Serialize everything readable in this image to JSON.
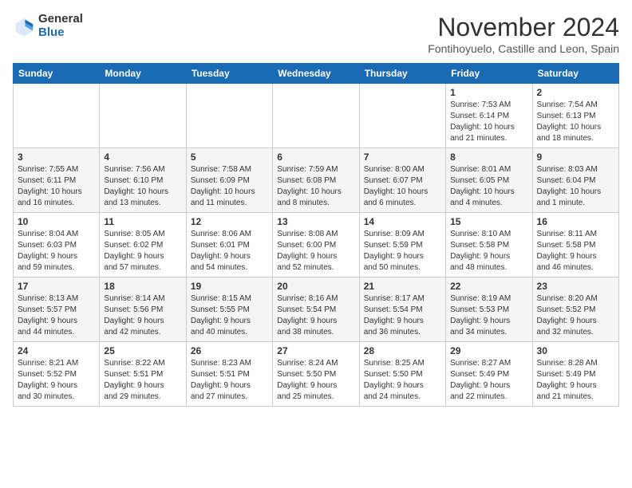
{
  "header": {
    "logo_general": "General",
    "logo_blue": "Blue",
    "month_title": "November 2024",
    "location": "Fontihoyuelo, Castille and Leon, Spain"
  },
  "days_of_week": [
    "Sunday",
    "Monday",
    "Tuesday",
    "Wednesday",
    "Thursday",
    "Friday",
    "Saturday"
  ],
  "weeks": [
    [
      {
        "day": "",
        "info": ""
      },
      {
        "day": "",
        "info": ""
      },
      {
        "day": "",
        "info": ""
      },
      {
        "day": "",
        "info": ""
      },
      {
        "day": "",
        "info": ""
      },
      {
        "day": "1",
        "info": "Sunrise: 7:53 AM\nSunset: 6:14 PM\nDaylight: 10 hours\nand 21 minutes."
      },
      {
        "day": "2",
        "info": "Sunrise: 7:54 AM\nSunset: 6:13 PM\nDaylight: 10 hours\nand 18 minutes."
      }
    ],
    [
      {
        "day": "3",
        "info": "Sunrise: 7:55 AM\nSunset: 6:11 PM\nDaylight: 10 hours\nand 16 minutes."
      },
      {
        "day": "4",
        "info": "Sunrise: 7:56 AM\nSunset: 6:10 PM\nDaylight: 10 hours\nand 13 minutes."
      },
      {
        "day": "5",
        "info": "Sunrise: 7:58 AM\nSunset: 6:09 PM\nDaylight: 10 hours\nand 11 minutes."
      },
      {
        "day": "6",
        "info": "Sunrise: 7:59 AM\nSunset: 6:08 PM\nDaylight: 10 hours\nand 8 minutes."
      },
      {
        "day": "7",
        "info": "Sunrise: 8:00 AM\nSunset: 6:07 PM\nDaylight: 10 hours\nand 6 minutes."
      },
      {
        "day": "8",
        "info": "Sunrise: 8:01 AM\nSunset: 6:05 PM\nDaylight: 10 hours\nand 4 minutes."
      },
      {
        "day": "9",
        "info": "Sunrise: 8:03 AM\nSunset: 6:04 PM\nDaylight: 10 hours\nand 1 minute."
      }
    ],
    [
      {
        "day": "10",
        "info": "Sunrise: 8:04 AM\nSunset: 6:03 PM\nDaylight: 9 hours\nand 59 minutes."
      },
      {
        "day": "11",
        "info": "Sunrise: 8:05 AM\nSunset: 6:02 PM\nDaylight: 9 hours\nand 57 minutes."
      },
      {
        "day": "12",
        "info": "Sunrise: 8:06 AM\nSunset: 6:01 PM\nDaylight: 9 hours\nand 54 minutes."
      },
      {
        "day": "13",
        "info": "Sunrise: 8:08 AM\nSunset: 6:00 PM\nDaylight: 9 hours\nand 52 minutes."
      },
      {
        "day": "14",
        "info": "Sunrise: 8:09 AM\nSunset: 5:59 PM\nDaylight: 9 hours\nand 50 minutes."
      },
      {
        "day": "15",
        "info": "Sunrise: 8:10 AM\nSunset: 5:58 PM\nDaylight: 9 hours\nand 48 minutes."
      },
      {
        "day": "16",
        "info": "Sunrise: 8:11 AM\nSunset: 5:58 PM\nDaylight: 9 hours\nand 46 minutes."
      }
    ],
    [
      {
        "day": "17",
        "info": "Sunrise: 8:13 AM\nSunset: 5:57 PM\nDaylight: 9 hours\nand 44 minutes."
      },
      {
        "day": "18",
        "info": "Sunrise: 8:14 AM\nSunset: 5:56 PM\nDaylight: 9 hours\nand 42 minutes."
      },
      {
        "day": "19",
        "info": "Sunrise: 8:15 AM\nSunset: 5:55 PM\nDaylight: 9 hours\nand 40 minutes."
      },
      {
        "day": "20",
        "info": "Sunrise: 8:16 AM\nSunset: 5:54 PM\nDaylight: 9 hours\nand 38 minutes."
      },
      {
        "day": "21",
        "info": "Sunrise: 8:17 AM\nSunset: 5:54 PM\nDaylight: 9 hours\nand 36 minutes."
      },
      {
        "day": "22",
        "info": "Sunrise: 8:19 AM\nSunset: 5:53 PM\nDaylight: 9 hours\nand 34 minutes."
      },
      {
        "day": "23",
        "info": "Sunrise: 8:20 AM\nSunset: 5:52 PM\nDaylight: 9 hours\nand 32 minutes."
      }
    ],
    [
      {
        "day": "24",
        "info": "Sunrise: 8:21 AM\nSunset: 5:52 PM\nDaylight: 9 hours\nand 30 minutes."
      },
      {
        "day": "25",
        "info": "Sunrise: 8:22 AM\nSunset: 5:51 PM\nDaylight: 9 hours\nand 29 minutes."
      },
      {
        "day": "26",
        "info": "Sunrise: 8:23 AM\nSunset: 5:51 PM\nDaylight: 9 hours\nand 27 minutes."
      },
      {
        "day": "27",
        "info": "Sunrise: 8:24 AM\nSunset: 5:50 PM\nDaylight: 9 hours\nand 25 minutes."
      },
      {
        "day": "28",
        "info": "Sunrise: 8:25 AM\nSunset: 5:50 PM\nDaylight: 9 hours\nand 24 minutes."
      },
      {
        "day": "29",
        "info": "Sunrise: 8:27 AM\nSunset: 5:49 PM\nDaylight: 9 hours\nand 22 minutes."
      },
      {
        "day": "30",
        "info": "Sunrise: 8:28 AM\nSunset: 5:49 PM\nDaylight: 9 hours\nand 21 minutes."
      }
    ]
  ]
}
